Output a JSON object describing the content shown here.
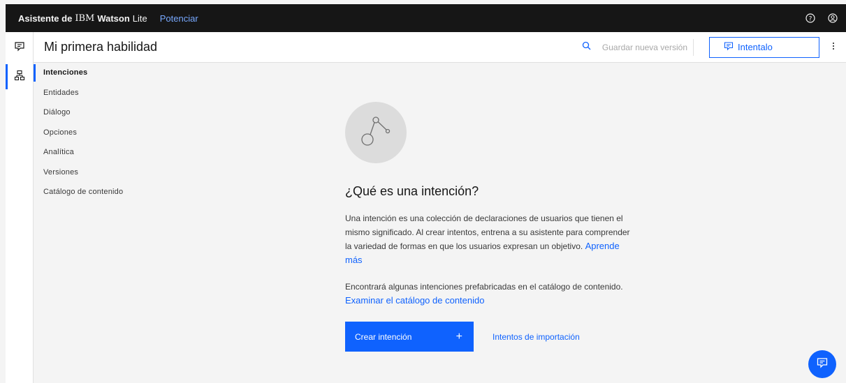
{
  "topbar": {
    "brand_prefix": "Asistente de",
    "brand_ibm": "IBM",
    "brand_watson": "Watson",
    "brand_lite": "Lite",
    "upgrade_label": "Potenciar",
    "help_icon": "help-icon",
    "user_icon": "user-avatar-icon"
  },
  "rail": {
    "items": [
      {
        "icon": "chat-icon"
      },
      {
        "icon": "skills-tree-icon",
        "active": true
      }
    ]
  },
  "header": {
    "title": "Mi primera habilidad",
    "search_icon": "search-icon",
    "save_version_label": "Guardar nueva versión",
    "try_label": "Intentalo",
    "overflow_icon": "overflow-menu-icon"
  },
  "leftnav": {
    "items": [
      {
        "label": "Intenciones",
        "active": true
      },
      {
        "label": "Entidades"
      },
      {
        "label": "Diálogo"
      },
      {
        "label": "Opciones"
      },
      {
        "label": "Analítica"
      },
      {
        "label": "Versiones"
      },
      {
        "label": "Catálogo de contenido"
      }
    ]
  },
  "main": {
    "hero_icon": "intent-graph-icon",
    "heading": "¿Qué es una intención?",
    "description": "Una intención es una colección de declaraciones de usuarios que tienen el mismo significado. Al crear intentos, entrena a su asistente para comprender la variedad de formas en que los usuarios expresan un objetivo.",
    "learn_more": "Aprende más",
    "catalog_text": "Encontrará algunas intenciones prefabricadas en el catálogo de contenido.",
    "catalog_link": "Examinar el catálogo de contenido",
    "create_label": "Crear intención",
    "create_icon": "+",
    "import_label": "Intentos de importación"
  },
  "colors": {
    "accent": "#0f62fe",
    "topbar_bg": "#161616",
    "page_bg": "#f4f4f4"
  }
}
